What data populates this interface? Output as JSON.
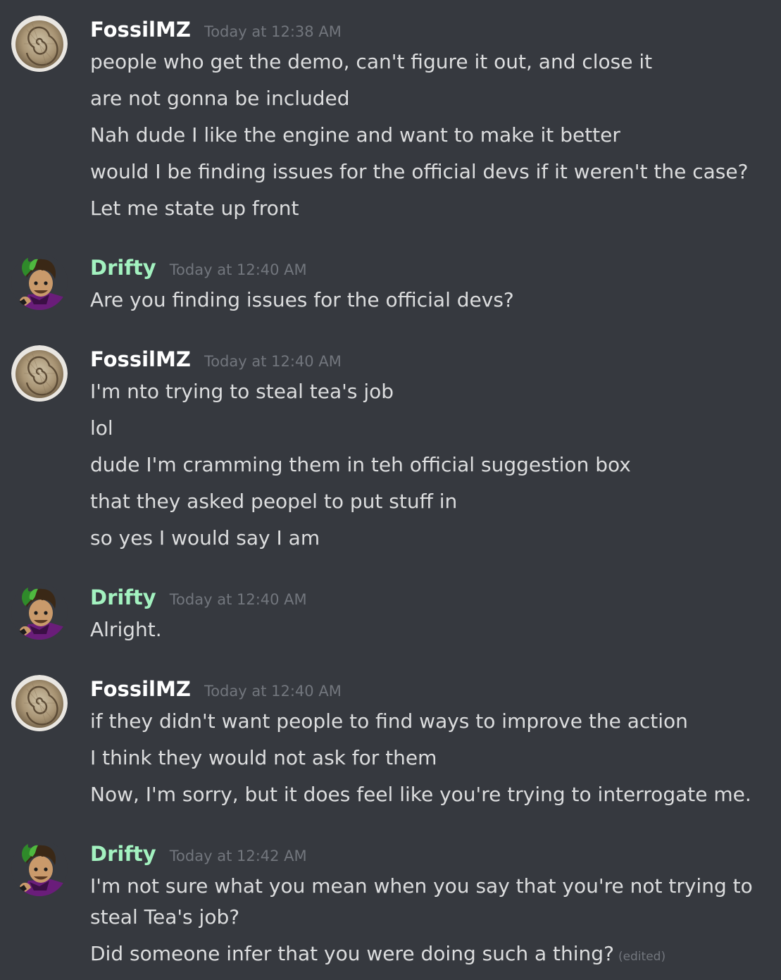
{
  "messages": [
    {
      "author": "FossilMZ",
      "timestamp": "Today at 12:38 AM",
      "lines": [
        "people who get the demo, can't figure it out, and close it",
        "are not gonna be included",
        "Nah dude I like the engine and want to make it better",
        "would I be finding issues for the official devs if it weren't the case?",
        "Let me state up front"
      ]
    },
    {
      "author": "Drifty",
      "timestamp": "Today at 12:40 AM",
      "lines": [
        "Are you finding issues for the official devs?"
      ]
    },
    {
      "author": "FossilMZ",
      "timestamp": "Today at 12:40 AM",
      "lines": [
        "I'm nto trying to steal tea's job",
        "lol",
        "dude I'm cramming them in teh official suggestion box",
        "that they asked peopel to put stuff in",
        "so yes I would say I am"
      ]
    },
    {
      "author": "Drifty",
      "timestamp": "Today at 12:40 AM",
      "lines": [
        "Alright."
      ]
    },
    {
      "author": "FossilMZ",
      "timestamp": "Today at 12:40 AM",
      "lines": [
        "if they didn't want people to find ways to improve the action",
        "I think they would not ask for them",
        "Now, I'm sorry, but it does feel like you're trying to interrogate me."
      ]
    },
    {
      "author": "Drifty",
      "timestamp": "Today at 12:42 AM",
      "lines": [
        "I'm not sure what you mean when you say that you're not trying to steal Tea's job?",
        "Did someone infer that you were doing such a thing?"
      ],
      "edited_label": "(edited)"
    }
  ],
  "colors": {
    "background": "#36393f",
    "text": "#dcddde",
    "timestamp": "#72767d",
    "fossil_name": "#ffffff",
    "drifty_name": "#a3f2c0"
  },
  "icons": {
    "fossil_avatar": "ammonite-fossil-avatar",
    "drifty_avatar": "green-haired-character-avatar"
  }
}
